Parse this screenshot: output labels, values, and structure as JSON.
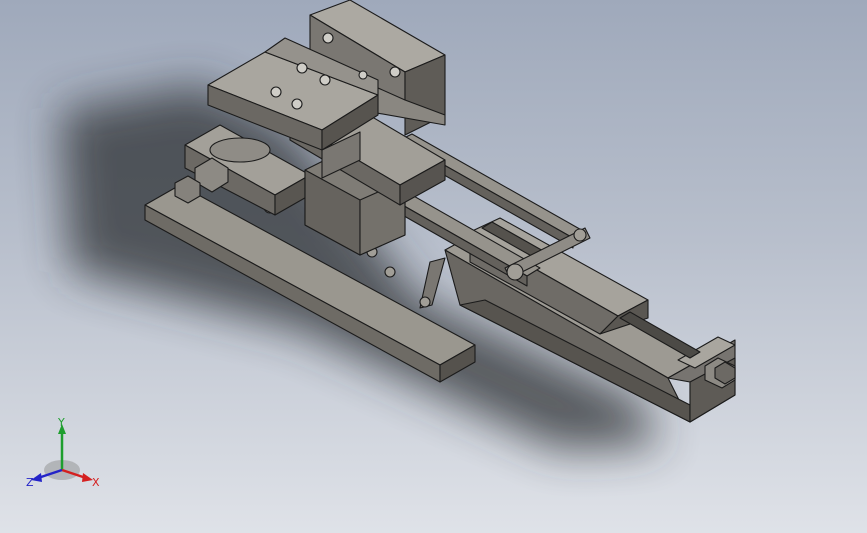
{
  "viewport": {
    "background_top": "#9fa9bb",
    "background_bottom": "#dfe2e8"
  },
  "model": {
    "part_color": "#8e8b85",
    "face_light": "#a8a59e",
    "face_dark": "#5f5c57",
    "edge_color": "#1b1b1b",
    "shadow_color": "#2e3136"
  },
  "triad": {
    "x_label": "X",
    "y_label": "Y",
    "z_label": "Z",
    "x_color": "#d42020",
    "y_color": "#1e9e2e",
    "z_color": "#2424c8"
  }
}
